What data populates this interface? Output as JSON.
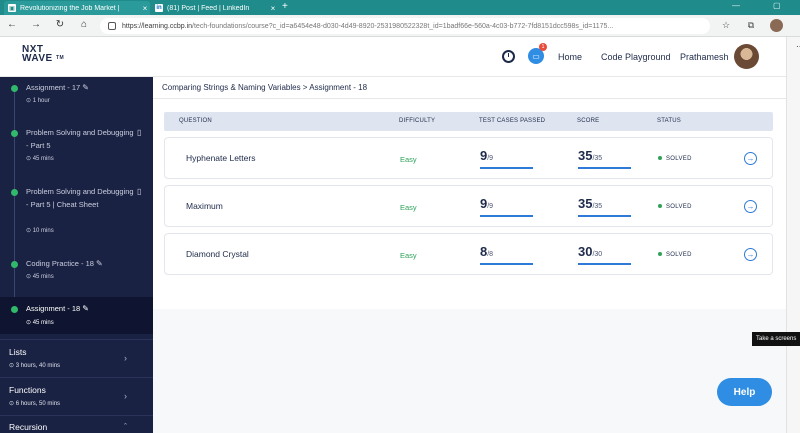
{
  "browser": {
    "tabs": [
      {
        "label": "Revolutionizing the Job Market |",
        "favicon": "nw"
      },
      {
        "label": "(81) Post | Feed | LinkedIn",
        "favicon": "in"
      }
    ],
    "url_main": "https://learning.ccbp.in",
    "url_rest": "/tech-foundations/course?c_id=a6454e48-d030-4d49-8920-25319805223​28t_id=1badf66e-560a-4c03-b772-7fd8151dcc598s_id=1175..."
  },
  "header": {
    "logo_top": "NXT",
    "logo_bottom": "WAVE",
    "logo_sub": "TM",
    "chat_badge": "1",
    "nav": [
      "Home",
      "Code Playground"
    ],
    "user_name": "Prathamesh"
  },
  "sidebar": {
    "items": [
      {
        "title": "Assignment - 17",
        "duration": "1 hour",
        "icon": "edit-icon"
      },
      {
        "title": "Problem Solving and Debugging - Part 5",
        "duration": "45 mins",
        "icon": "book-icon"
      },
      {
        "title": "Problem Solving and Debugging - Part 5 | Cheat Sheet",
        "duration": "10 mins",
        "icon": "book-icon"
      },
      {
        "title": "Coding Practice - 18",
        "duration": "45 mins",
        "icon": "edit-icon"
      },
      {
        "title": "Assignment - 18",
        "duration": "45 mins",
        "icon": "edit-icon"
      }
    ],
    "modules": [
      {
        "name": "Lists",
        "duration": "3 hours, 40 mins"
      },
      {
        "name": "Functions",
        "duration": "6 hours, 50 mins"
      },
      {
        "name": "Recursion",
        "duration": ""
      }
    ]
  },
  "main": {
    "breadcrumb": "Comparing Strings & Naming Variables > Assignment - 18",
    "columns": [
      "QUESTION",
      "DIFFICULTY",
      "TEST CASES PASSED",
      "SCORE",
      "STATUS"
    ],
    "rows": [
      {
        "question": "Hyphenate Letters",
        "difficulty": "Easy",
        "tc_passed": "9",
        "tc_total": "/9",
        "score": "35",
        "score_total": "/35",
        "status": "SOLVED"
      },
      {
        "question": "Maximum",
        "difficulty": "Easy",
        "tc_passed": "9",
        "tc_total": "/9",
        "score": "35",
        "score_total": "/35",
        "status": "SOLVED"
      },
      {
        "question": "Diamond Crystal",
        "difficulty": "Easy",
        "tc_passed": "8",
        "tc_total": "/8",
        "score": "30",
        "score_total": "/30",
        "status": "SOLVED"
      }
    ]
  },
  "tooltip": "Take a screens",
  "help_label": "Help",
  "colors": {
    "sidebar": "#1a2244",
    "accent": "#2f8de4",
    "success": "#2ea25b"
  }
}
